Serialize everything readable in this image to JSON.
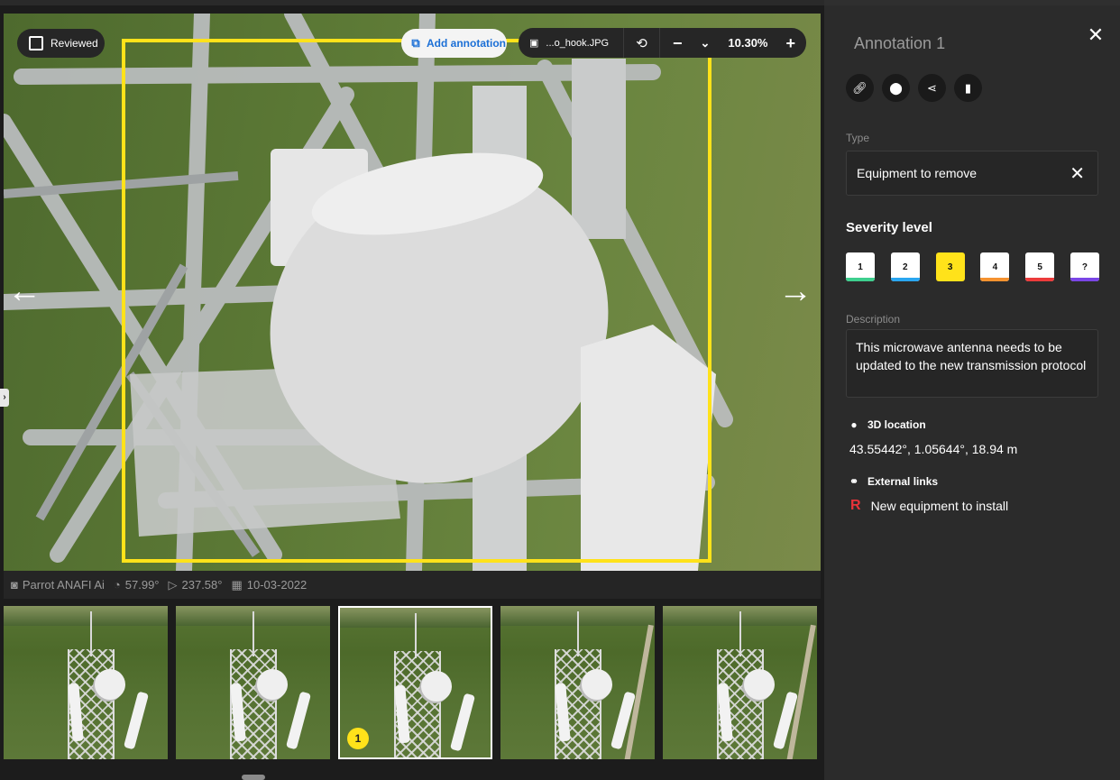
{
  "viewer": {
    "reviewed_label": "Reviewed",
    "add_annotation_label": "Add annotation",
    "file_name": "...o_hook.JPG",
    "zoom": "10.30%",
    "zoom_out": "−",
    "zoom_in": "+",
    "zoom_dropdown": "⌄",
    "prev": "←",
    "next": "→",
    "annotation_color": "#ffe21a"
  },
  "meta": {
    "camera": "Parrot ANAFI Ai",
    "pitch": "57.99°",
    "heading": "237.58°",
    "date": "10-03-2022"
  },
  "thumbnails": {
    "selected_badge": "1"
  },
  "panel": {
    "title": "Annotation 1",
    "type_label": "Type",
    "type_value": "Equipment to remove",
    "severity_title": "Severity level",
    "severity": [
      {
        "label": "1",
        "color": "#3ecf8e"
      },
      {
        "label": "2",
        "color": "#2aa6f0"
      },
      {
        "label": "3",
        "color": "#ffe21a"
      },
      {
        "label": "4",
        "color": "#f5922f"
      },
      {
        "label": "5",
        "color": "#ec3b3b"
      },
      {
        "label": "?",
        "color": "#7a45e6"
      }
    ],
    "severity_selected": "3",
    "description_label": "Description",
    "description": "This microwave antenna needs to be updated to the new transmission protocol",
    "location_label": "3D location",
    "location_value": "43.55442°, 1.05644°, 18.94 m",
    "links_label": "External links",
    "link_icon_letter": "R",
    "link_text": "New equipment to install"
  }
}
